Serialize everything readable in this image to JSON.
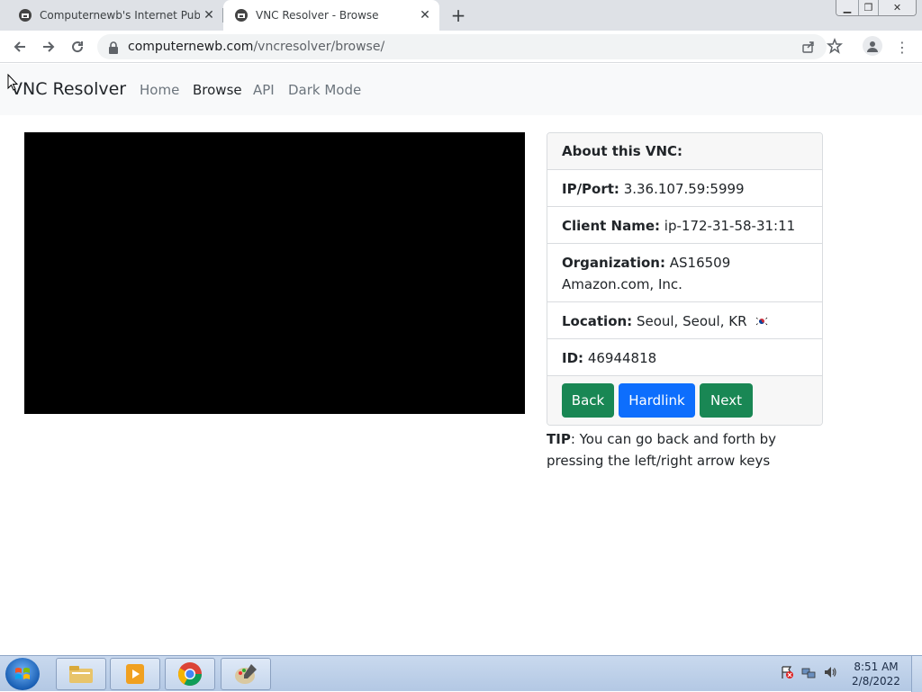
{
  "browser": {
    "tabs": [
      {
        "title": "Computernewb's Internet Pub H",
        "active": false
      },
      {
        "title": "VNC Resolver - Browse",
        "active": true
      }
    ],
    "url_host": "computernewb.com",
    "url_path": "/vncresolver/browse/"
  },
  "navbar": {
    "brand": "VNC Resolver",
    "links": [
      "Home",
      "Browse",
      "API",
      "Dark Mode"
    ],
    "active_link": "Browse"
  },
  "about": {
    "header": "About this VNC:",
    "ip_label": "IP/Port:",
    "ip_value": "3.36.107.59:5999",
    "client_label": "Client Name:",
    "client_value": "ip-172-31-58-31:11",
    "org_label": "Organization:",
    "org_value": "AS16509 Amazon.com, Inc.",
    "location_label": "Location:",
    "location_value": "Seoul, Seoul, KR",
    "location_flag": "south-korea-flag-icon",
    "id_label": "ID:",
    "id_value": "46944818"
  },
  "buttons": {
    "back": "Back",
    "hardlink": "Hardlink",
    "next": "Next"
  },
  "tip": {
    "label": "TIP",
    "text": ": You can go back and forth by pressing the left/right arrow keys"
  },
  "taskbar": {
    "time": "8:51 AM",
    "date": "2/8/2022"
  },
  "colors": {
    "green": "#198754",
    "blue": "#0d6efd",
    "navbar_bg": "#f8f9fa"
  }
}
